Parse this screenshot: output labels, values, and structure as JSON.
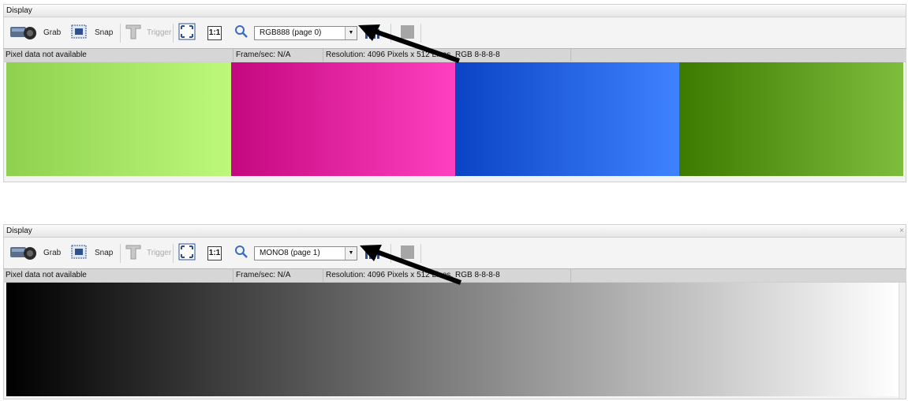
{
  "panels": [
    {
      "title": "Display",
      "toolbar": {
        "grab_label": "Grab",
        "snap_label": "Snap",
        "trigger_label": "Trigger",
        "one_to_one_label": "1:1",
        "page_select_value": "RGB888 (page 0)"
      },
      "status": {
        "pixel": "Pixel data not available",
        "fps": "Frame/sec: N/A",
        "resolution": "Resolution: 4096 Pixels x 512 Lines, RGB 8-8-8-8"
      },
      "image_colors": [
        [
          "#8fd14f",
          "#bdf87a"
        ],
        [
          "#c4087f",
          "#ff40c0"
        ],
        [
          "#0a44c4",
          "#3f82ff"
        ],
        [
          "#3c7a00",
          "#7ebd3c"
        ]
      ]
    },
    {
      "title": "Display",
      "close_glyph": "×",
      "toolbar": {
        "grab_label": "Grab",
        "snap_label": "Snap",
        "trigger_label": "Trigger",
        "one_to_one_label": "1:1",
        "page_select_value": "MONO8 (page 1)"
      },
      "status": {
        "pixel": "Pixel data not available",
        "fps": "Frame/sec: N/A",
        "resolution": "Resolution: 4096 Pixels x 512 Lines, RGB 8-8-8-8"
      },
      "image_colors": [
        [
          "#000000",
          "#ffffff"
        ]
      ]
    }
  ],
  "icons": {
    "camera": "camera-icon",
    "snap": "snap-icon",
    "trigger": "trigger-icon",
    "fit": "fit-to-window-icon",
    "zoom": "magnifier-icon",
    "dropdown": "chevron-down-icon",
    "histogram": "histogram-icon",
    "stop": "stop-icon",
    "annotation": "arrow-annotation"
  }
}
